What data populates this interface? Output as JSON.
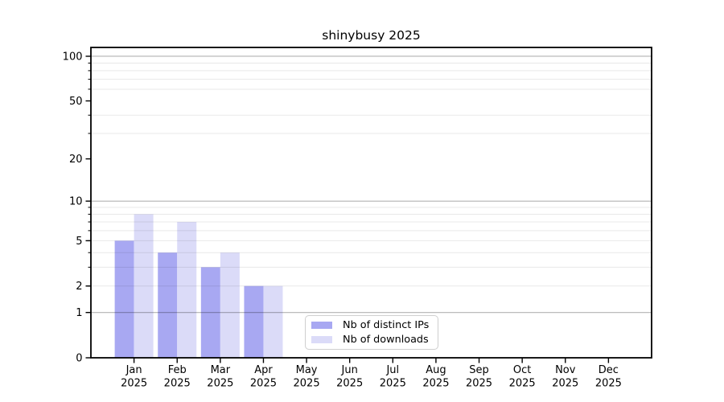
{
  "chart_data": {
    "type": "bar",
    "title": "shinybusy 2025",
    "categories": [
      "Jan",
      "Feb",
      "Mar",
      "Apr",
      "May",
      "Jun",
      "Jul",
      "Aug",
      "Sep",
      "Oct",
      "Nov",
      "Dec"
    ],
    "x_year_label": "2025",
    "series": [
      {
        "name": "Nb of distinct IPs",
        "color": "#a8a8f2",
        "values": [
          5,
          4,
          3,
          2,
          0,
          0,
          0,
          0,
          0,
          0,
          0,
          0
        ]
      },
      {
        "name": "Nb of downloads",
        "color": "#dbdbf8",
        "values": [
          8,
          7,
          4,
          2,
          0,
          0,
          0,
          0,
          0,
          0,
          0,
          0
        ]
      }
    ],
    "xlabel": "",
    "ylabel": "",
    "y_scale": "log1p",
    "ylim": [
      0,
      114.6
    ],
    "y_ticks": [
      0,
      1,
      2,
      5,
      10,
      20,
      50,
      100
    ],
    "y_major_gridlines": [
      1,
      10,
      100
    ],
    "y_minor_gridlines": [
      2,
      3,
      4,
      5,
      6,
      7,
      8,
      9,
      30,
      40,
      60,
      70,
      80,
      90
    ],
    "grid": "on",
    "legend_position": "inside lower center"
  },
  "colors": {
    "axis": "#000000",
    "tick_label": "#000000",
    "major_grid_rgba": "rgba(0,0,0,0.30)",
    "minor_grid_rgba": "rgba(0,0,0,0.09)",
    "legend_border": "#cfcfcf"
  }
}
